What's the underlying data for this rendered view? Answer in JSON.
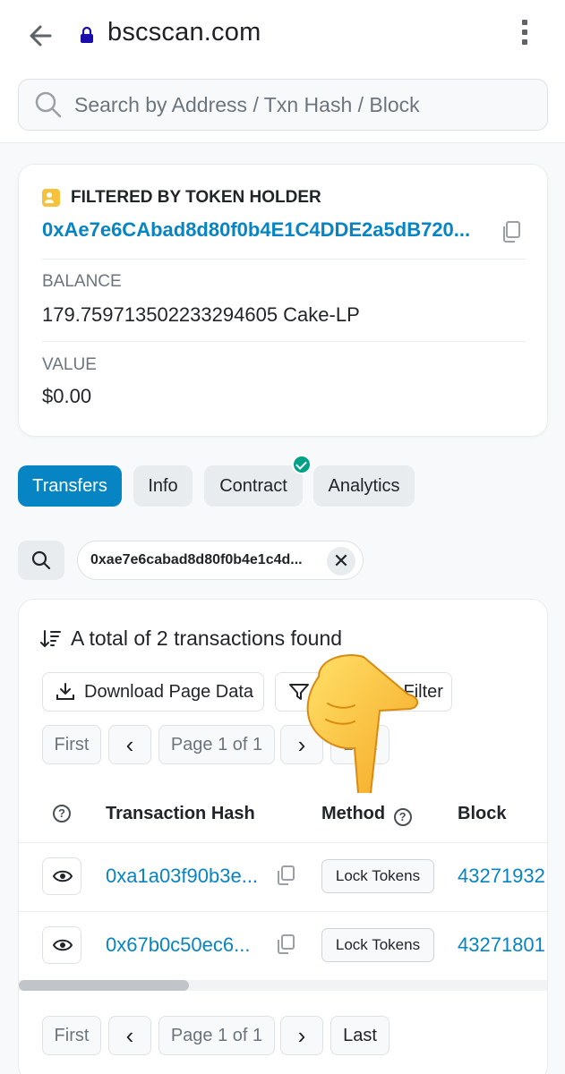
{
  "browser": {
    "url": "bscscan.com"
  },
  "search": {
    "placeholder": "Search by Address / Txn Hash / Block"
  },
  "holder": {
    "title": "FILTERED BY TOKEN HOLDER",
    "address": "0xAe7e6CAbad8d80f0b4E1C4DDE2a5dB720...",
    "balance_label": "BALANCE",
    "balance_value": "179.759713502233294605 Cake-LP",
    "value_label": "VALUE",
    "value_value": "$0.00"
  },
  "tabs": [
    {
      "label": "Transfers",
      "active": true
    },
    {
      "label": "Info"
    },
    {
      "label": "Contract",
      "verified": true
    },
    {
      "label": "Analytics"
    }
  ],
  "filter": {
    "chip_text": "0xae7e6cabad8d80f0b4e1c4d...",
    "close": "✕"
  },
  "list": {
    "summary": "A total of 2 transactions found",
    "download_label": "Download Page Data",
    "advanced_filter_label": "Advanced Filter",
    "pagination_top": {
      "first": "First",
      "prev": "‹",
      "page": "Page 1 of 1",
      "next": "›",
      "last": "Last"
    },
    "pagination_bottom": {
      "first": "First",
      "prev": "‹",
      "page": "Page 1 of 1",
      "next": "›",
      "last": "Last"
    },
    "columns": {
      "hash": "Transaction Hash",
      "method": "Method",
      "block": "Block"
    },
    "rows": [
      {
        "hash": "0xa1a03f90b3e...",
        "method": "Lock Tokens",
        "block": "43271932"
      },
      {
        "hash": "0x67b0c50ec6...",
        "method": "Lock Tokens",
        "block": "43271801"
      }
    ]
  },
  "colors": {
    "accent": "#0784c3",
    "verified": "#00a186",
    "holder_icon": "#f6c23e"
  }
}
